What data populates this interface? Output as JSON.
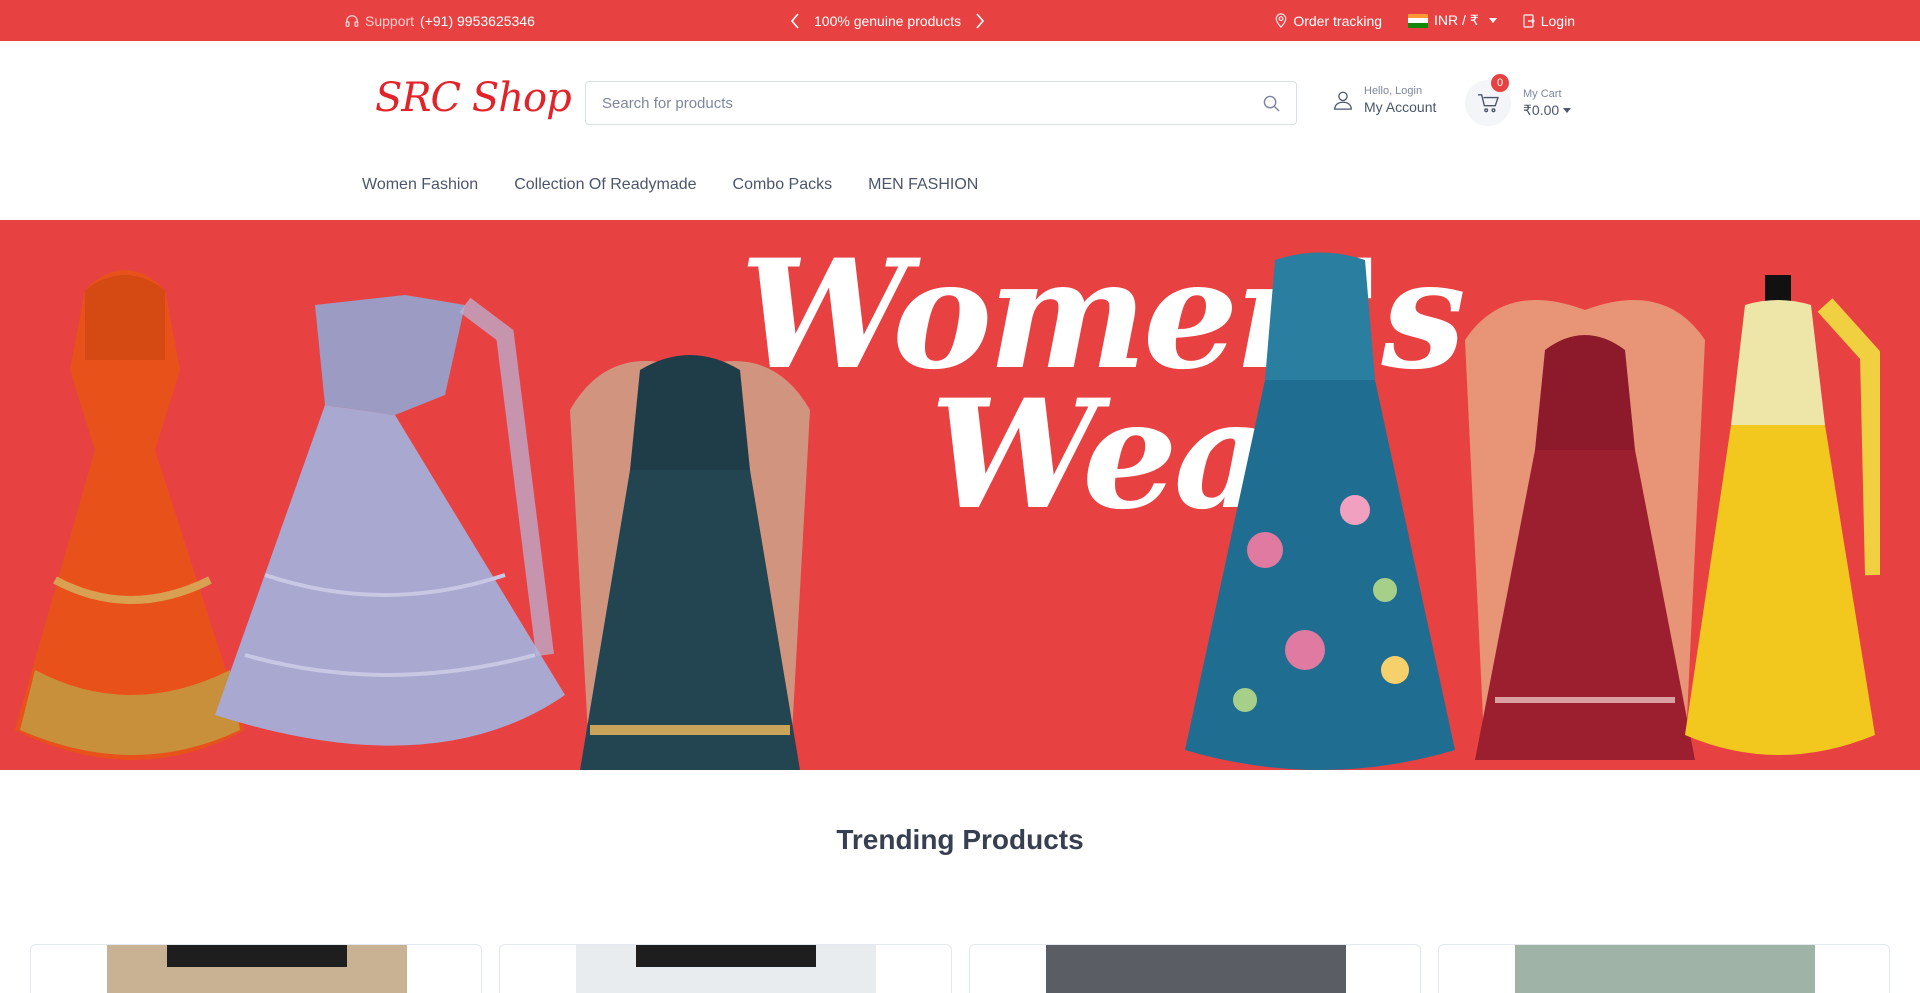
{
  "topbar": {
    "support_label": "Support",
    "support_phone": "(+91) 9953625346",
    "promo": "100% genuine products",
    "order_tracking": "Order tracking",
    "currency": "INR / ₹",
    "login": "Login"
  },
  "header": {
    "logo": "SRC Shop",
    "search_placeholder": "Search for products",
    "account_small": "Hello, Login",
    "account_big": "My Account",
    "cart_count": "0",
    "cart_small": "My Cart",
    "cart_total": "₹0.00"
  },
  "nav": {
    "items": [
      "Women Fashion",
      "Collection Of Readymade",
      "Combo Packs",
      "MEN FASHION"
    ]
  },
  "banner": {
    "line1": "Women's",
    "line2": "Wear"
  },
  "trending": {
    "title": "Trending Products"
  },
  "colors": {
    "brand_red": "#e84142",
    "text_dark": "#373f50"
  }
}
